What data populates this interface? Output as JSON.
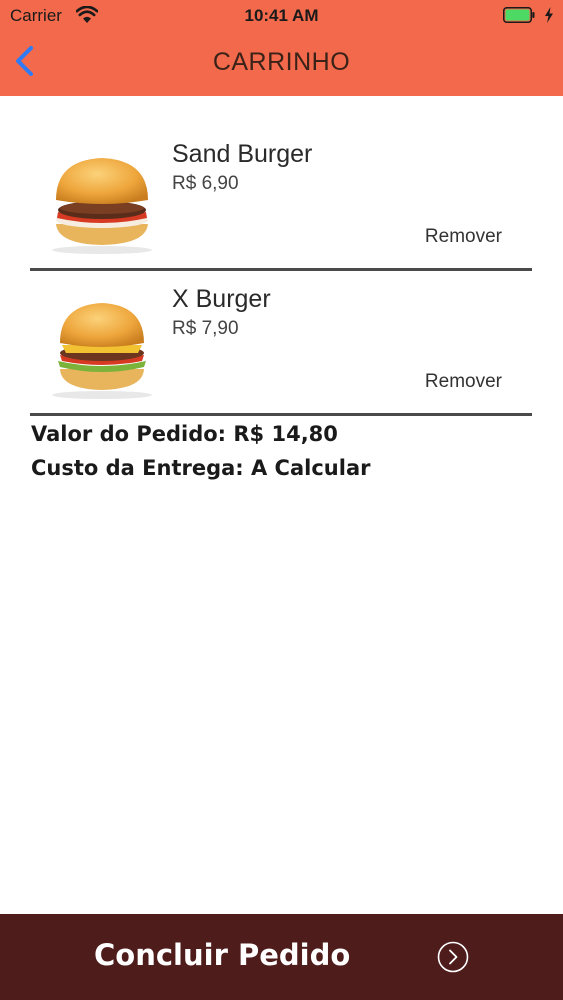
{
  "status_bar": {
    "carrier": "Carrier",
    "time": "10:41 AM"
  },
  "nav": {
    "title": "CARRINHO",
    "back_icon": "chevron-left-icon"
  },
  "cart": {
    "items": [
      {
        "name": "Sand Burger",
        "price": "R$ 6,90",
        "remove_label": "Remover",
        "image": "burger-image"
      },
      {
        "name": "X Burger",
        "price": "R$ 7,90",
        "remove_label": "Remover",
        "image": "burger-image"
      }
    ]
  },
  "summary": {
    "order_value": "Valor do Pedido: R$ 14,80",
    "delivery_cost": "Custo da Entrega: A Calcular"
  },
  "footer": {
    "button_label": "Concluir Pedido",
    "icon": "chevron-circle-right-icon"
  },
  "colors": {
    "header_bg": "#f26a4b",
    "footer_bg": "#4f1c1c",
    "back_icon": "#2f7bf5",
    "battery": "#4cd964"
  }
}
